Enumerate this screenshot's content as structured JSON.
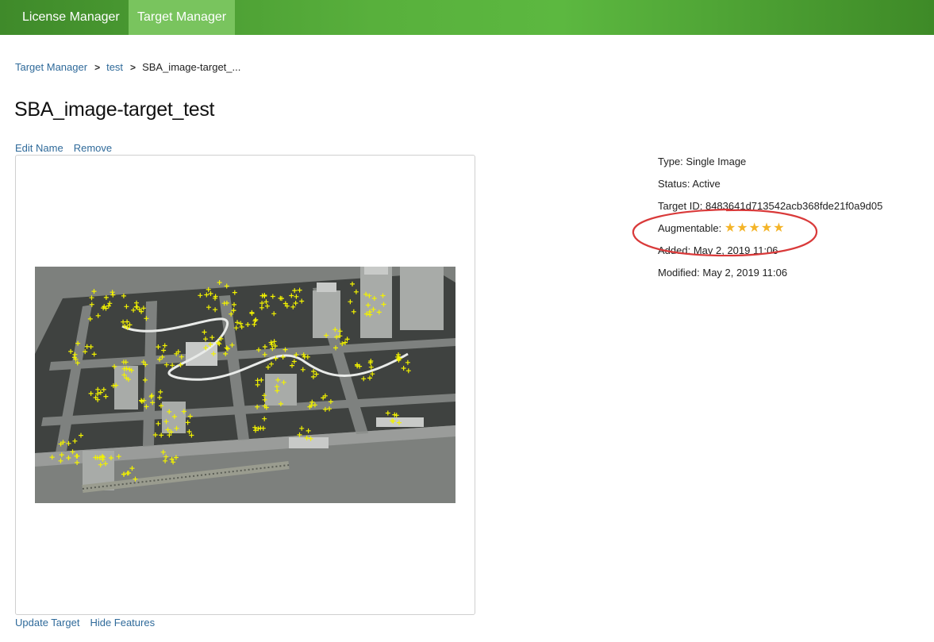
{
  "nav": {
    "items": [
      {
        "label": "License Manager",
        "active": false
      },
      {
        "label": "Target Manager",
        "active": true
      }
    ]
  },
  "breadcrumb": {
    "items": [
      "Target Manager",
      "test"
    ],
    "current": "SBA_image-target_..."
  },
  "page": {
    "title": "SBA_image-target_test"
  },
  "title_actions": [
    "Edit Name",
    "Remove"
  ],
  "bottom_actions": [
    "Update Target",
    "Hide Features"
  ],
  "target_info": {
    "type": "Type: Single Image",
    "status": "Status: Active",
    "target_id": "Target ID: 8483641d713542acb368fde21f0a9d05",
    "augmentable_label": "Augmentable:",
    "augmentable_rating": 5,
    "augmentable_max": 5,
    "added": "Added: May 2, 2019 11:06",
    "modified": "Modified: May 2, 2019 11:06"
  },
  "colors": {
    "nav_green": "#4fa334",
    "link_blue": "#2f6a9a",
    "star_gold": "#f4b428",
    "feature_marker": "#f2f200",
    "annotation_red": "#d93a3a"
  }
}
